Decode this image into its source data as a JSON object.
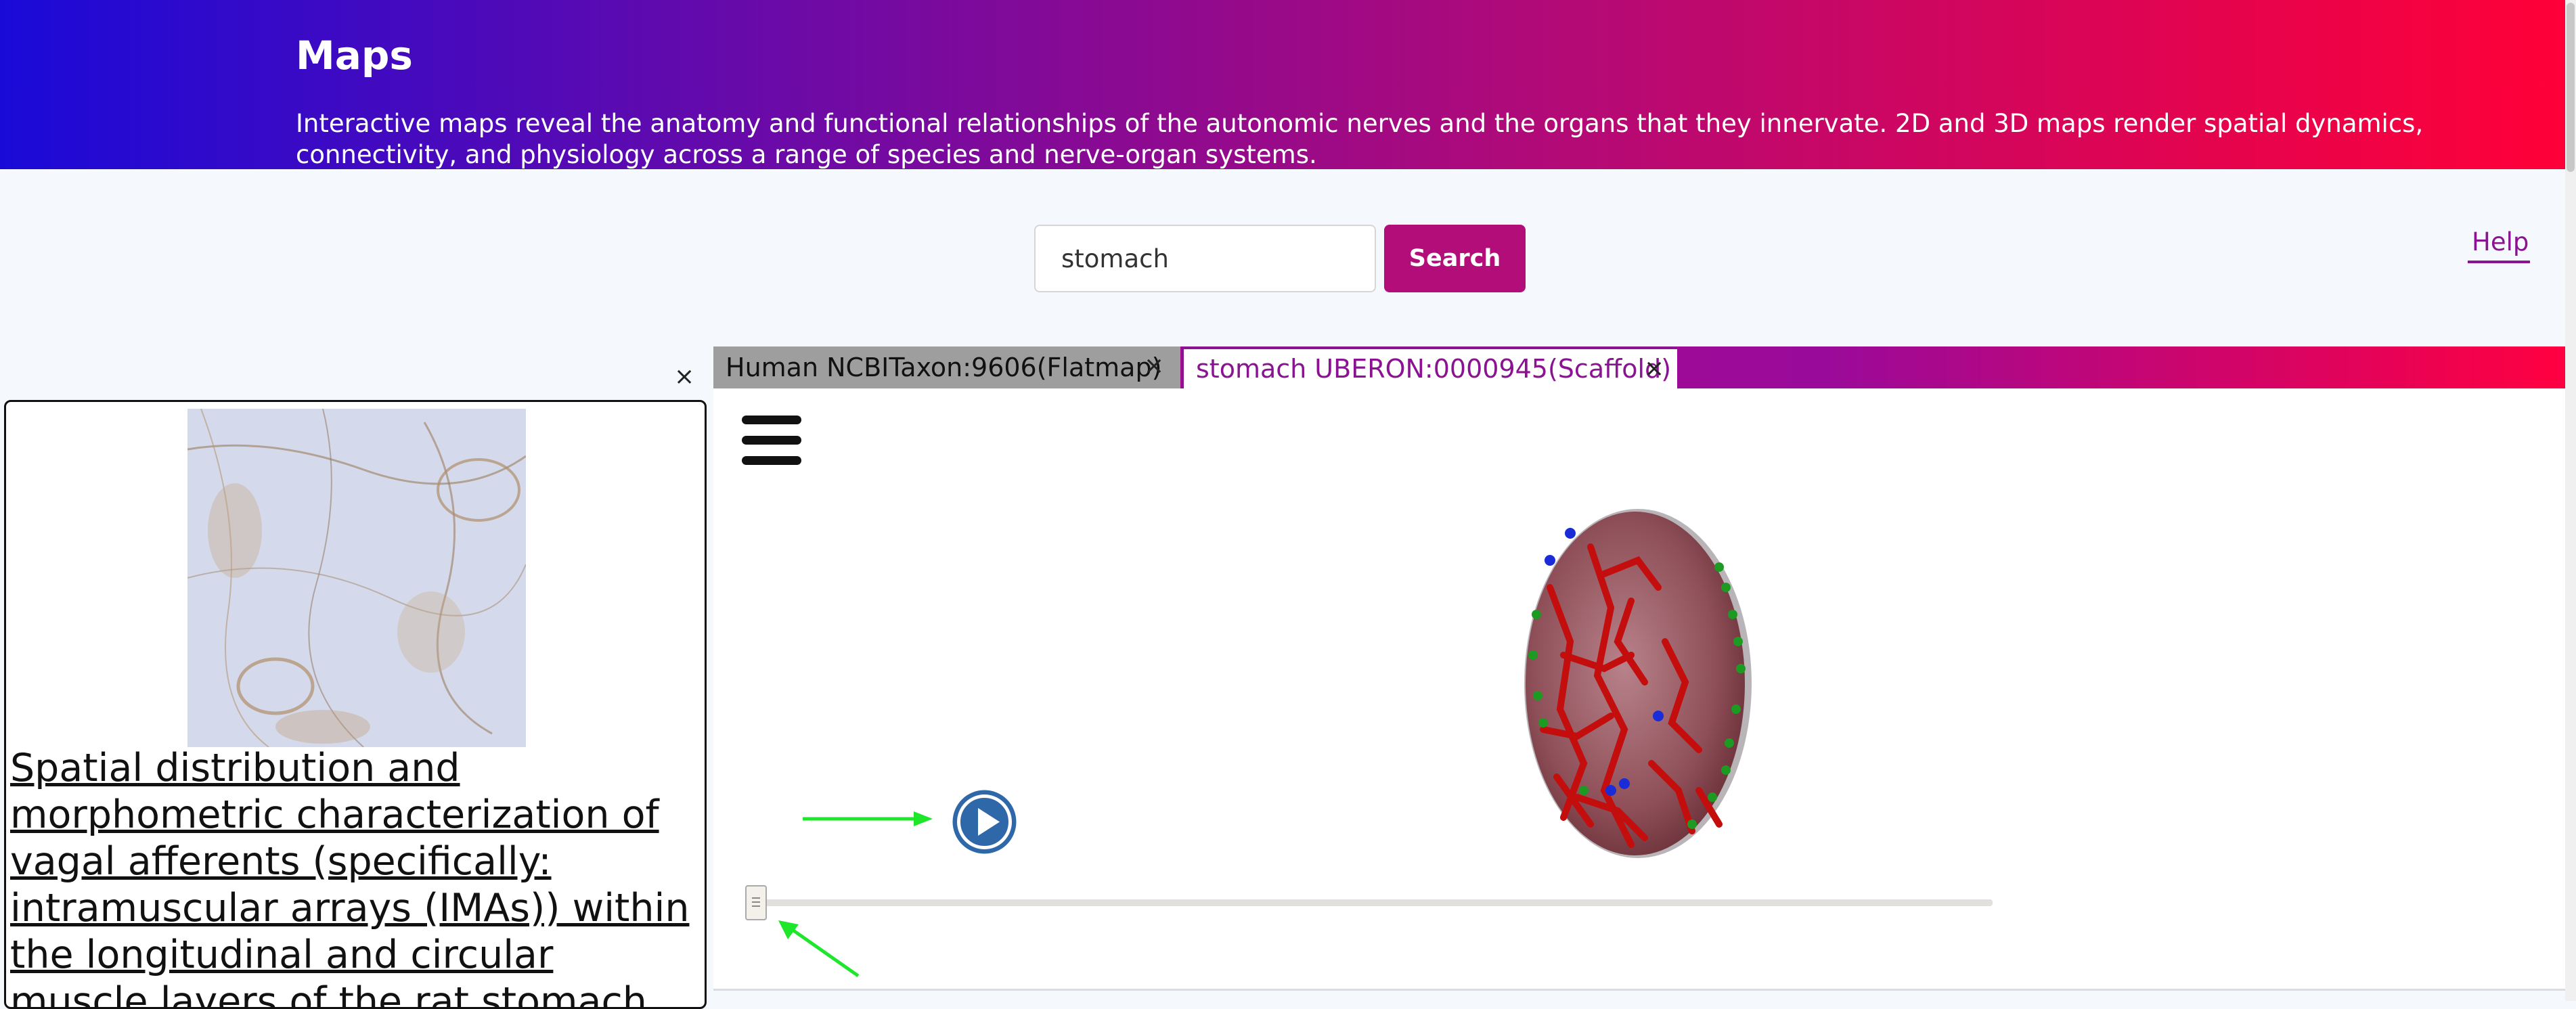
{
  "header": {
    "title": "Maps",
    "description": "Interactive maps reveal the anatomy and functional relationships of the autonomic nerves and the organs that they innervate. 2D and 3D maps render spatial dynamics, connectivity, and physiology across a range of species and nerve-organ systems."
  },
  "search": {
    "value": "stomach",
    "button_label": "Search"
  },
  "help": {
    "label": "Help"
  },
  "tabs": [
    {
      "label": "Human NCBITaxon:9606(Flatmap)",
      "close": "×",
      "active": false
    },
    {
      "label": "stomach UBERON:0000945(Scaffold)",
      "close": "×",
      "active": true
    }
  ],
  "left_panel": {
    "close": "×",
    "paper_title": "Spatial distribution and morphometric characterization of vagal afferents (specifically: intramuscular arrays (IMAs)) within the longitudinal and circular muscle layers of the rat stomach"
  },
  "viewer": {
    "menu_icon": "hamburger-icon",
    "play_icon": "play-icon",
    "timeline_progress": 0
  },
  "colors": {
    "brand": "#b30d7a",
    "accent": "#8a1391",
    "header_gradient_start": "#1a0ad8",
    "header_gradient_end": "#ff0038",
    "play": "#2f68a8",
    "annotation_arrow": "#1ee62a"
  }
}
